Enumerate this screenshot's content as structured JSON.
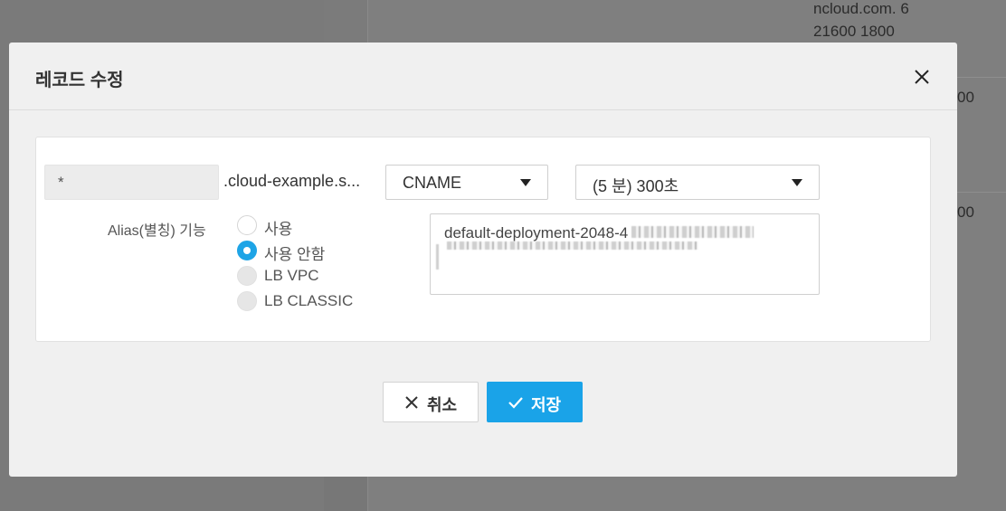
{
  "background": {
    "lines": [
      "ncloud.com. 6",
      "21600 1800",
      "00",
      "00"
    ]
  },
  "modal": {
    "title": "레코드 수정",
    "record": {
      "name_value": "*",
      "domain_suffix": ".cloud-example.s...",
      "type_value": "CNAME",
      "ttl_value": "(5 분) 300초",
      "alias_label": "Alias(별칭) 기능",
      "alias_options": [
        {
          "label": "사용",
          "state": "unchecked"
        },
        {
          "label": "사용 안함",
          "state": "checked"
        },
        {
          "label": "LB VPC",
          "state": "disabled"
        },
        {
          "label": "LB CLASSIC",
          "state": "disabled"
        }
      ],
      "value_text": "default-deployment-2048-4"
    },
    "buttons": {
      "cancel_label": "취소",
      "save_label": "저장"
    }
  },
  "colors": {
    "accent": "#1aa3e8",
    "overlay": "#7f7f7f"
  },
  "icons": {
    "close": "close-icon",
    "cancel": "x-icon",
    "save": "check-icon",
    "dropdown": "caret-down-icon"
  }
}
